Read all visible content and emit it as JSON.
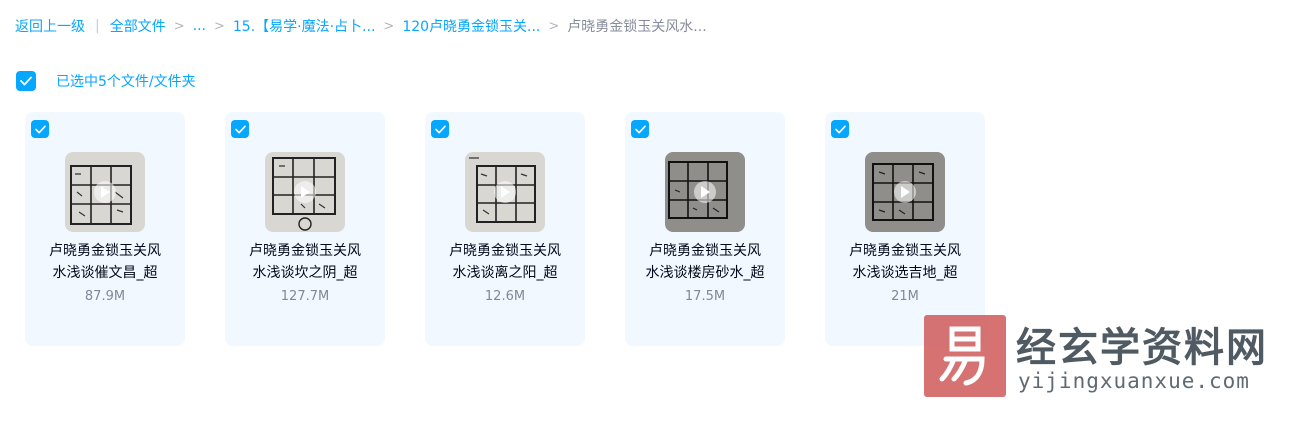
{
  "breadcrumb": {
    "back": "返回上一级",
    "all_files": "全部文件",
    "ellipsis": "...",
    "level1": "15.【易学·魔法·占卜...",
    "level2": "120卢晓勇金锁玉关...",
    "current": "卢晓勇金锁玉关风水..."
  },
  "selection": {
    "label": "已选中5个文件/文件夹"
  },
  "files": [
    {
      "name_line1": "卢晓勇金锁玉关风",
      "name_line2": "水浅谈催文昌_超",
      "size": "87.9M"
    },
    {
      "name_line1": "卢晓勇金锁玉关风",
      "name_line2": "水浅谈坎之阴_超",
      "size": "127.7M"
    },
    {
      "name_line1": "卢晓勇金锁玉关风",
      "name_line2": "水浅谈离之阳_超",
      "size": "12.6M"
    },
    {
      "name_line1": "卢晓勇金锁玉关风",
      "name_line2": "水浅谈楼房砂水_超",
      "size": "17.5M"
    },
    {
      "name_line1": "卢晓勇金锁玉关风",
      "name_line2": "水浅谈选吉地_超",
      "size": "21M"
    }
  ],
  "watermark": {
    "title": "经玄学资料网",
    "url": "yijingxuanxue.com"
  },
  "colors": {
    "accent": "#06a7ff",
    "card_bg": "#f1f8ff",
    "text": "#03081a",
    "muted": "#818999"
  },
  "icons": {
    "checkbox": "check-icon",
    "play": "play-icon",
    "separator": "chevron-right-icon"
  }
}
